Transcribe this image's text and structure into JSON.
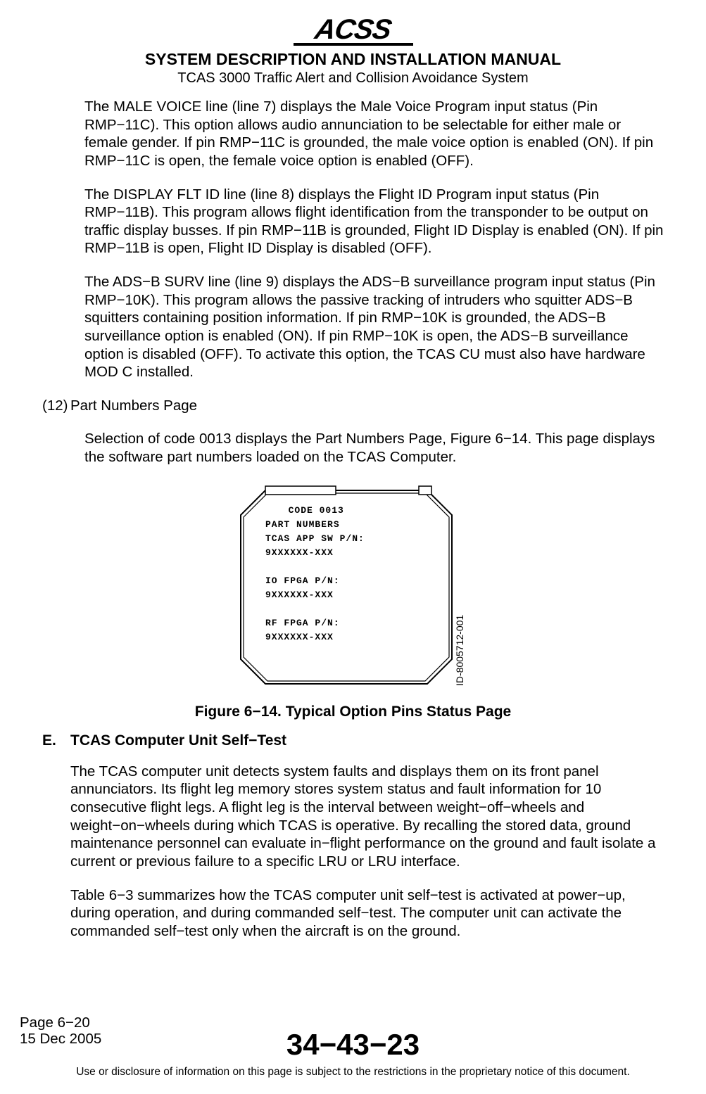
{
  "header": {
    "logo_text": "ACSS",
    "title": "SYSTEM DESCRIPTION AND INSTALLATION MANUAL",
    "subtitle": "TCAS 3000 Traffic Alert and Collision Avoidance System"
  },
  "paragraphs": {
    "male_voice": "The MALE VOICE line (line 7) displays the Male Voice Program input status (Pin RMP−11C).  This option allows audio annunciation to be selectable for either male or female gender.  If pin RMP−11C is grounded, the male voice option is enabled (ON).  If pin RMP−11C is open, the female voice option is enabled (OFF).",
    "display_flt": "The DISPLAY FLT ID line (line 8) displays the Flight ID Program input status (Pin RMP−11B).  This program allows flight identification from the transponder to be output on traffic display busses.  If pin RMP−11B is grounded, Flight ID Display is enabled (ON).  If pin RMP−11B is open, Flight ID Display is disabled (OFF).",
    "ads_b": "The ADS−B SURV line (line 9) displays the ADS−B surveillance program input status (Pin RMP−10K).  This program allows the passive tracking of intruders who squitter ADS−B squitters containing position information.  If pin RMP−10K is grounded, the ADS−B surveillance option is enabled (ON).  If pin RMP−10K is open, the ADS−B surveillance option is disabled (OFF).  To activate this option, the TCAS CU must also have hardware MOD C installed.",
    "item12_num": "(12)",
    "item12_title": "Part Numbers Page",
    "item12_body": "Selection of code 0013 displays the Part Numbers Page,  Figure 6−14.  This page displays the software part numbers loaded on the TCAS Computer.",
    "section_e_letter": "E.",
    "section_e_title": "TCAS Computer Unit Self−Test",
    "section_e_p1": "The TCAS computer unit detects system faults and displays them on its front panel annunciators.  Its flight leg memory stores system status and fault information for 10 consecutive flight legs.  A flight leg is the interval between weight−off−wheels and weight−on−wheels during which TCAS is operative.  By recalling the stored data, ground maintenance personnel can evaluate in−flight performance on the ground and fault isolate a current or previous failure to a specific LRU or LRU interface.",
    "section_e_p2": "Table 6−3 summarizes how the TCAS computer unit self−test is activated at power−up, during operation, and during commanded self−test.  The computer unit can activate the commanded self−test only when the aircraft is on the ground."
  },
  "figure": {
    "caption": "Figure 6−14.  Typical Option Pins Status Page",
    "id_label": "ID-8005712-001",
    "lcd_lines": [
      "  CODE 0013",
      "PART NUMBERS",
      "TCAS APP SW P/N:",
      "9XXXXXX-XXX",
      "",
      "IO FPGA P/N:",
      "9XXXXXX-XXX",
      "",
      "RF FPGA P/N:",
      "9XXXXXX-XXX"
    ]
  },
  "footer": {
    "page_num": "Page 6−20",
    "date": "15 Dec 2005",
    "doc_code": "34−43−23",
    "disclaimer": "Use or disclosure of information on this page is subject to the restrictions in the proprietary notice of this document."
  }
}
